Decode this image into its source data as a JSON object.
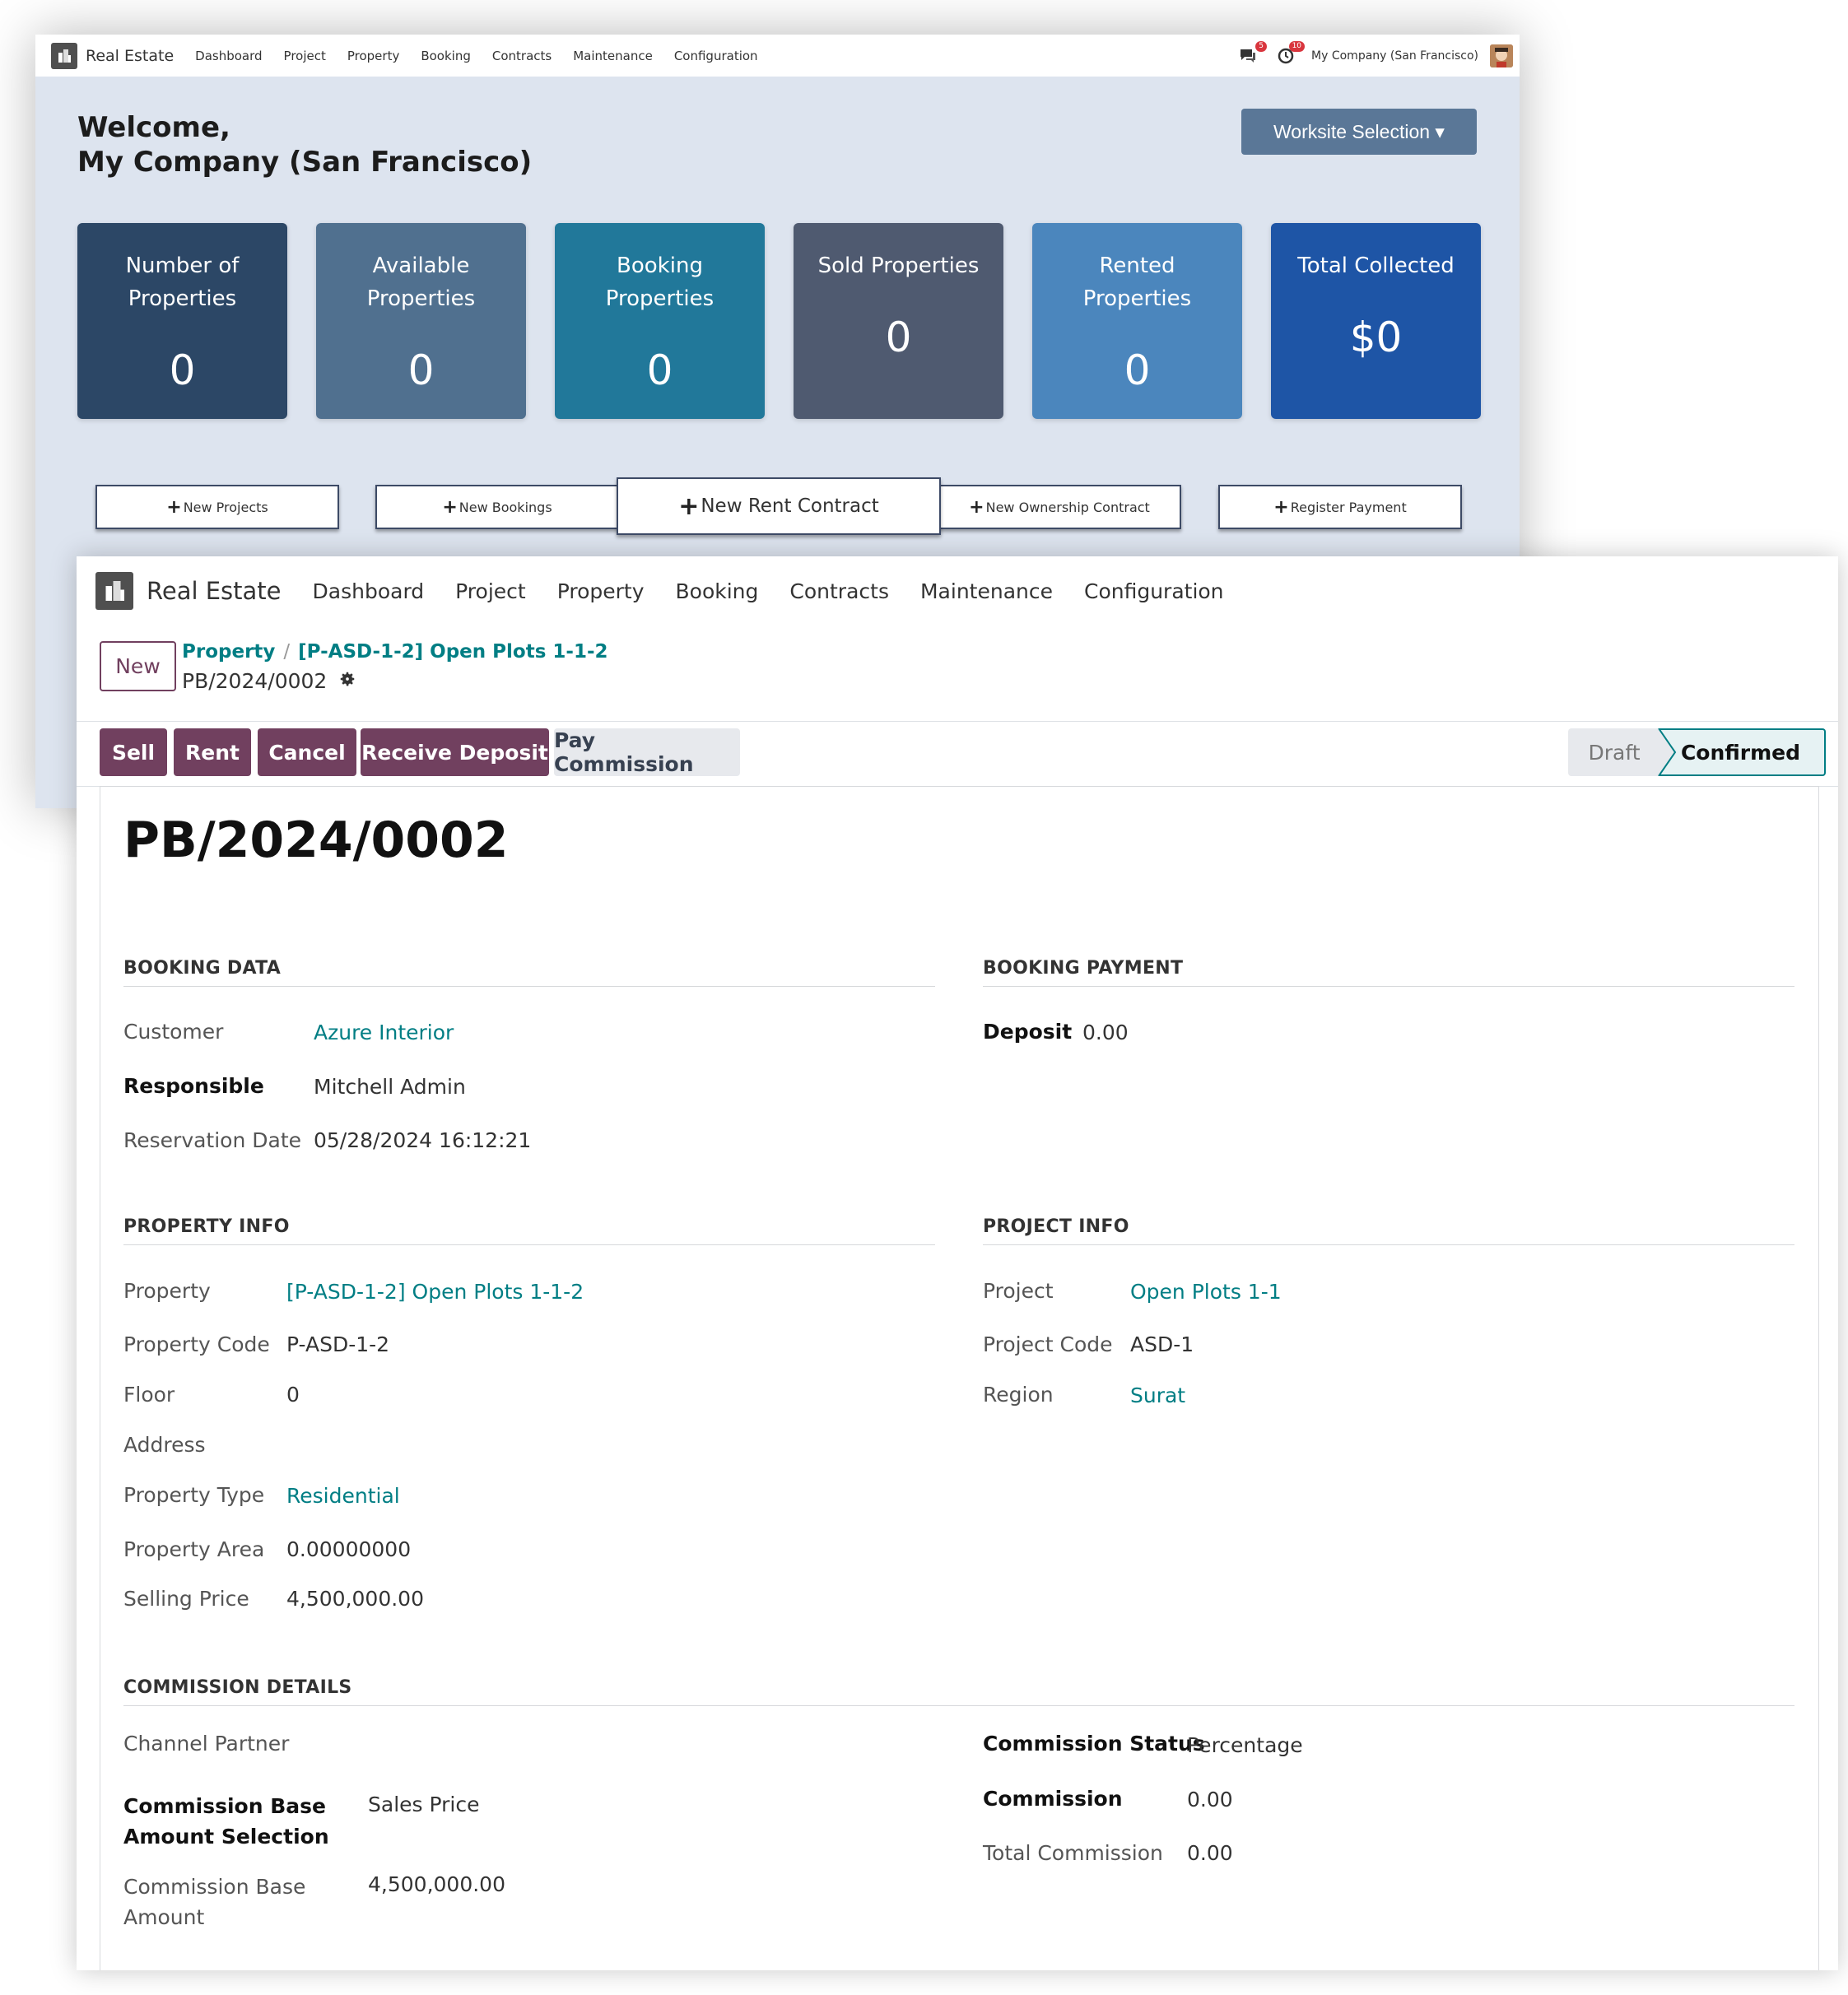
{
  "back": {
    "nav": {
      "app": "Real Estate",
      "items": [
        "Dashboard",
        "Project",
        "Property",
        "Booking",
        "Contracts",
        "Maintenance",
        "Configuration"
      ],
      "messages_badge": "5",
      "activities_badge": "10",
      "company": "My Company (San Francisco)"
    },
    "welcome_line1": "Welcome,",
    "welcome_line2": "My Company (San Francisco)",
    "worksite_label": "Worksite Selection ▾",
    "cards": [
      {
        "l1": "Number of",
        "l2": "Properties",
        "value": "0",
        "color": "#2c4766"
      },
      {
        "l1": "Available",
        "l2": "Properties",
        "value": "0",
        "color": "#50708f"
      },
      {
        "l1": "Booking",
        "l2": "Properties",
        "value": "0",
        "color": "#21789a"
      },
      {
        "l1": "Sold Properties",
        "value": "0",
        "color": "#4f5a70"
      },
      {
        "l1": "Rented",
        "l2": "Properties",
        "value": "0",
        "color": "#4b86bd"
      },
      {
        "l1": "Total Collected",
        "value": "$0",
        "color": "#1e55a6"
      }
    ],
    "actions": [
      "New Projects",
      "New Bookings",
      "New Rent Contract",
      "New Ownership Contract",
      "Register Payment"
    ]
  },
  "front": {
    "nav": {
      "app": "Real Estate",
      "items": [
        "Dashboard",
        "Project",
        "Property",
        "Booking",
        "Contracts",
        "Maintenance",
        "Configuration"
      ]
    },
    "new_button": "New",
    "breadcrumb": [
      "Property",
      "[P-ASD-1-2] Open Plots 1-1-2"
    ],
    "record_name": "PB/2024/0002",
    "buttons": [
      "Sell",
      "Rent",
      "Cancel",
      "Receive Deposit",
      "Pay Commission"
    ],
    "stages": [
      "Draft",
      "Confirmed"
    ],
    "title": "PB/2024/0002",
    "booking_data": {
      "heading": "BOOKING DATA",
      "customer_label": "Customer",
      "customer": "Azure Interior",
      "responsible_label": "Responsible",
      "responsible": "Mitchell Admin",
      "reservation_label": "Reservation Date",
      "reservation": "05/28/2024 16:12:21"
    },
    "booking_payment": {
      "heading": "BOOKING PAYMENT",
      "deposit_label": "Deposit",
      "deposit": "0.00"
    },
    "property_info": {
      "heading": "PROPERTY INFO",
      "property_label": "Property",
      "property": "[P-ASD-1-2] Open Plots 1-1-2",
      "code_label": "Property Code",
      "code": "P-ASD-1-2",
      "floor_label": "Floor",
      "floor": "0",
      "address_label": "Address",
      "type_label": "Property Type",
      "type": "Residential",
      "area_label": "Property Area",
      "area": "0.00000000",
      "price_label": "Selling Price",
      "price": "4,500,000.00"
    },
    "project_info": {
      "heading": "PROJECT INFO",
      "project_label": "Project",
      "project": "Open Plots 1-1",
      "code_label": "Project Code",
      "code": "ASD-1",
      "region_label": "Region",
      "region": "Surat"
    },
    "commission": {
      "heading": "COMMISSION DETAILS",
      "channel_label": "Channel Partner",
      "base_sel_label1": "Commission Base",
      "base_sel_label2": "Amount Selection",
      "base_sel": "Sales Price",
      "base_amt_label1": "Commission Base",
      "base_amt_label2": "Amount",
      "base_amt": "4,500,000.00",
      "status_label": "Commission Status",
      "status": "Percentage",
      "commission_label": "Commission",
      "commission": "0.00",
      "total_label": "Total Commission",
      "total": "0.00"
    }
  }
}
